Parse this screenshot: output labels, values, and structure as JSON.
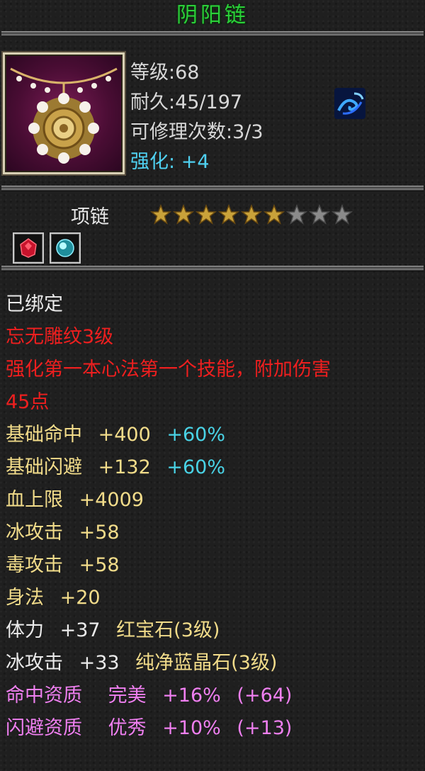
{
  "item": {
    "name": "阴阳链",
    "type": "项链",
    "colors": {
      "title": "#2ccf3a",
      "red": "#ee1f1f",
      "yellow": "#f2dc8a",
      "cyan": "#49d3e6",
      "pink": "#ef7ff0"
    },
    "icon": "necklace-portrait",
    "bind_icon": "blue-swirl-icon",
    "stars": {
      "filled": 6,
      "total": 9
    },
    "gems": [
      {
        "name": "red-gem-icon"
      },
      {
        "name": "blue-gem-icon"
      }
    ]
  },
  "stats": {
    "level": "等级:68",
    "durability": "耐久:45/197",
    "repair": "可修理次数:3/3",
    "enhance_label": "强化:",
    "enhance_value": "+4"
  },
  "desc": {
    "bound": "已绑定",
    "engrave": "忘无雕纹3级",
    "effect_line1": "强化第一本心法第一个技能，附加伤害",
    "effect_line2": "45点",
    "attrs": [
      {
        "label": "基础命中",
        "value": "+400",
        "extra": "+60%"
      },
      {
        "label": "基础闪避",
        "value": "+132",
        "extra": "+60%"
      },
      {
        "label": "血上限",
        "value": "+4009"
      },
      {
        "label": "冰攻击",
        "value": "+58"
      },
      {
        "label": "毒攻击",
        "value": "+58"
      },
      {
        "label": "身法",
        "value": "+20"
      },
      {
        "label": "体力",
        "value": "+37",
        "gem": "红宝石(3级)"
      },
      {
        "label": "冰攻击",
        "value": "+33",
        "gem": "纯净蓝晶石(3级)"
      }
    ],
    "quality": [
      {
        "label": "命中资质",
        "grade": "完美",
        "value": "+16%",
        "bonus": "(+64)"
      },
      {
        "label": "闪避资质",
        "grade": "优秀",
        "value": "+10%",
        "bonus": "(+13)"
      }
    ]
  }
}
